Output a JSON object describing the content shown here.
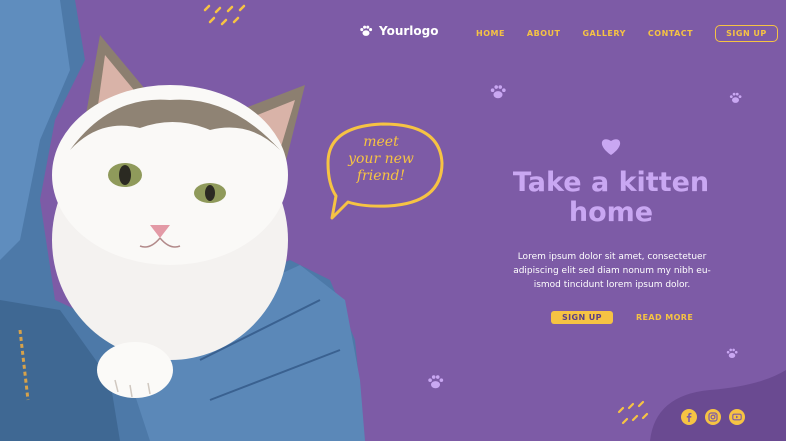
{
  "header": {
    "logo_text": "Yourlogo",
    "nav": [
      {
        "label": "HOME"
      },
      {
        "label": "ABOUT"
      },
      {
        "label": "GALLERY"
      },
      {
        "label": "CONTACT"
      }
    ],
    "signup_label": "SIGN UP"
  },
  "bubble": {
    "lines": [
      "meet",
      "your new",
      "friend!"
    ]
  },
  "hero": {
    "title_line1": "Take a kitten",
    "title_line2": "home",
    "paragraph": "Lorem ipsum dolor sit amet, consectetuer adipiscing elit sed diam nonum my nibh eu-ismod tincidunt lorem ipsum dolor.",
    "signup_label": "SIGN UP",
    "read_more_label": "READ MORE"
  },
  "socials": [
    {
      "icon": "facebook-icon"
    },
    {
      "icon": "instagram-icon"
    },
    {
      "icon": "youtube-icon"
    }
  ],
  "colors": {
    "background": "#7d5ba6",
    "accent": "#f6c343",
    "title": "#c9a7f2"
  }
}
